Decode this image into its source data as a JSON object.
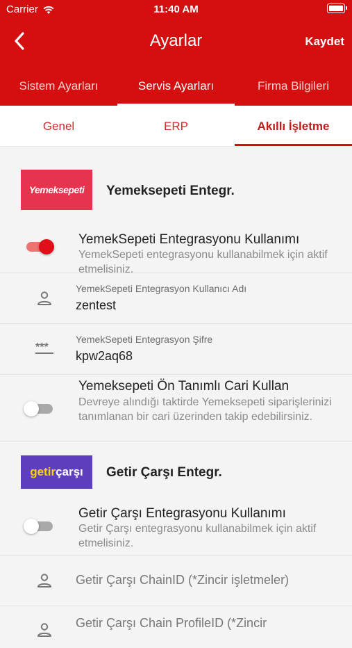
{
  "status_bar": {
    "carrier": "Carrier",
    "time": "11:40 AM"
  },
  "header": {
    "title": "Ayarlar",
    "save_label": "Kaydet"
  },
  "top_tabs": [
    {
      "label": "Sistem Ayarları"
    },
    {
      "label": "Servis Ayarları"
    },
    {
      "label": "Firma Bilgileri"
    }
  ],
  "sub_tabs": [
    {
      "label": "Genel"
    },
    {
      "label": "ERP"
    },
    {
      "label": "Akıllı İşletme"
    }
  ],
  "yemeksepeti": {
    "logo_text": "Yemeksepeti",
    "title": "Yemeksepeti Entegr.",
    "use_integration": {
      "title": "YemekSepeti Entegrasyonu Kullanımı",
      "description": "YemekSepeti entegrasyonu kullanabilmek için aktif etmelisiniz.",
      "enabled": true
    },
    "username": {
      "label": "YemekSepeti Entegrasyon Kullanıcı Adı",
      "value": "zentest"
    },
    "password": {
      "label": "YemekSepeti Entegrasyon Şifre",
      "value": "kpw2aq68"
    },
    "default_account": {
      "title": "Yemeksepeti Ön Tanımlı Cari Kullan",
      "description": "Devreye alındığı taktirde Yemeksepeti siparişlerinizi tanımlanan bir cari üzerinden takip edebilirsiniz.",
      "enabled": false
    }
  },
  "getir": {
    "logo_text_1": "getir",
    "logo_text_2": "çarşı",
    "title": "Getir Çarşı Entegr.",
    "use_integration": {
      "title": "Getir Çarşı Entegrasyonu Kullanımı",
      "description": "Getir Çarşı entegrasyonu kullanabilmek için aktif etmelisiniz.",
      "enabled": false
    },
    "chain_id": {
      "placeholder": "Getir Çarşı ChainID (*Zincir işletmeler)"
    },
    "chain_profile_id": {
      "placeholder": "Getir Çarşı Chain ProfileID (*Zincir"
    }
  },
  "colors": {
    "brand_red": "#d50f0f",
    "yemeksepeti_red": "#e6344e",
    "getir_purple": "#5d3ebc",
    "getir_yellow": "#ffd300"
  },
  "icons": [
    "back-chevron-icon",
    "wifi-icon",
    "battery-icon",
    "user-icon",
    "password-icon"
  ]
}
